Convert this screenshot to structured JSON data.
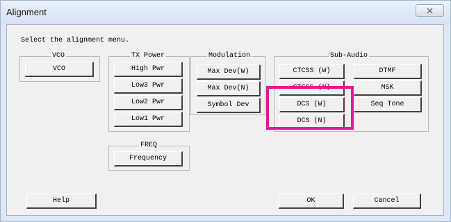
{
  "window": {
    "title": "Alignment"
  },
  "prompt": "Select the alignment menu.",
  "groups": {
    "vco": {
      "label": "VCO",
      "buttons": [
        "VCO"
      ]
    },
    "tx_power": {
      "label": "TX Power",
      "buttons": [
        "High Pwr",
        "Low3 Pwr",
        "Low2 Pwr",
        "Low1 Pwr"
      ]
    },
    "modulation": {
      "label": "Modulation",
      "buttons": [
        "Max Dev(W)",
        "Max Dev(N)",
        "Symbol Dev"
      ]
    },
    "sub_audio": {
      "label": "Sub-Audio",
      "buttons": [
        "CTCSS (W)",
        "CTCSS (N)",
        "DCS (W)",
        "DCS (N)",
        "DTMF",
        "MSK",
        "Seq Tone"
      ]
    },
    "freq": {
      "label": "FREQ",
      "buttons": [
        "Frequency"
      ]
    }
  },
  "footer": {
    "help": "Help",
    "ok": "OK",
    "cancel": "Cancel"
  },
  "colors": {
    "highlight": "#e3179a",
    "title_bar": "#dfe9f5",
    "client_bg": "#f0f0f0"
  },
  "icons": {
    "close": "close-icon"
  }
}
